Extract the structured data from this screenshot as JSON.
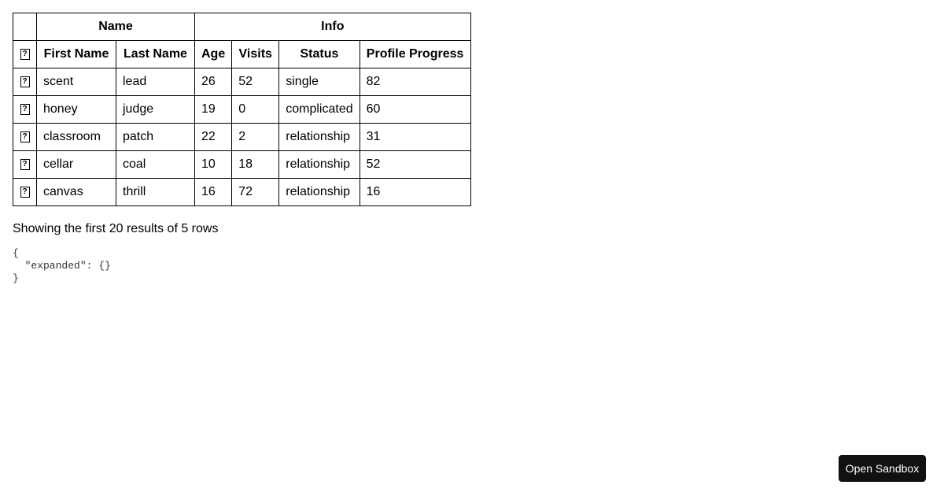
{
  "table": {
    "group_headers": {
      "name": "Name",
      "info": "Info"
    },
    "expander_glyph": "?",
    "columns": {
      "first_name": "First Name",
      "last_name": "Last Name",
      "age": "Age",
      "visits": "Visits",
      "status": "Status",
      "progress": "Profile Progress"
    },
    "rows": [
      {
        "first_name": "scent",
        "last_name": "lead",
        "age": "26",
        "visits": "52",
        "status": "single",
        "progress": "82"
      },
      {
        "first_name": "honey",
        "last_name": "judge",
        "age": "19",
        "visits": "0",
        "status": "complicated",
        "progress": "60"
      },
      {
        "first_name": "classroom",
        "last_name": "patch",
        "age": "22",
        "visits": "2",
        "status": "relationship",
        "progress": "31"
      },
      {
        "first_name": "cellar",
        "last_name": "coal",
        "age": "10",
        "visits": "18",
        "status": "relationship",
        "progress": "52"
      },
      {
        "first_name": "canvas",
        "last_name": "thrill",
        "age": "16",
        "visits": "72",
        "status": "relationship",
        "progress": "16"
      }
    ]
  },
  "summary_text": "Showing the first 20 results of 5 rows",
  "state_json": "{\n  \"expanded\": {}\n}",
  "sandbox_button_label": "Open Sandbox"
}
